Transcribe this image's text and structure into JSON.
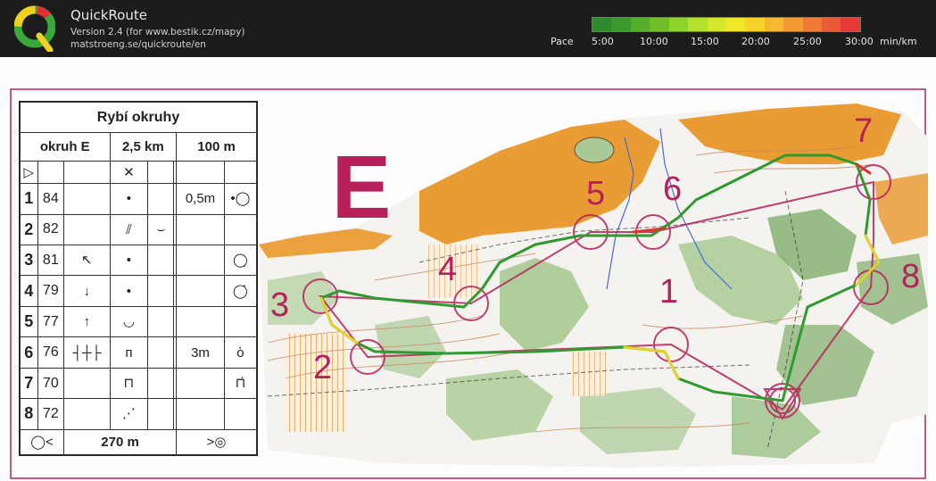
{
  "app": {
    "title": "QuickRoute",
    "version_line": "Version 2.4  (for www.bestik.cz/mapy)",
    "url_line": "matstroeng.se/quickroute/en"
  },
  "pace": {
    "label": "Pace",
    "unit": "min/km",
    "ticks": [
      "5:00",
      "10:00",
      "15:00",
      "20:00",
      "25:00",
      "30:00"
    ],
    "gradient": [
      "#2e8b2e",
      "#3a9a2c",
      "#55ad2a",
      "#70bf28",
      "#8fd22a",
      "#b4e02e",
      "#d6e62e",
      "#f0e62a",
      "#f7d22a",
      "#f6b830",
      "#f39a32",
      "#ee7a34",
      "#ea5a36",
      "#e43a38"
    ]
  },
  "map": {
    "course_letter": "E",
    "control_numbers": [
      "1",
      "2",
      "3",
      "4",
      "5",
      "6",
      "7",
      "8"
    ],
    "colors": {
      "course": "#b8205a",
      "forest_orange": "#e8921e",
      "green": "#7fae6a",
      "route_green": "#2f9a2f",
      "route_yellow": "#e6d22a",
      "route_red": "#d8342a"
    }
  },
  "description": {
    "title": "Rybí okruhy",
    "course": "okruh E",
    "length": "2,5 km",
    "climb": "100 m",
    "start_symbol": "▷",
    "start_feature": "✕",
    "rows": [
      {
        "num": "1",
        "code": "84",
        "c": "",
        "d": "•",
        "e": "",
        "f": "",
        "g": "0,5m",
        "h": "•◯"
      },
      {
        "num": "2",
        "code": "82",
        "c": "",
        "d": "⫽",
        "e": "⌣",
        "f": "",
        "g": "",
        "h": ""
      },
      {
        "num": "3",
        "code": "81",
        "c": "↖",
        "d": "•",
        "e": "",
        "f": "",
        "g": "",
        "h": "◯̣"
      },
      {
        "num": "4",
        "code": "79",
        "c": "↓",
        "d": "•",
        "e": "",
        "f": "",
        "g": "",
        "h": "◯̇"
      },
      {
        "num": "5",
        "code": "77",
        "c": "↑",
        "d": "◡",
        "e": "",
        "f": "",
        "g": "",
        "h": ""
      },
      {
        "num": "6",
        "code": "76",
        "c": "┤┼├",
        "d": "ᴨ",
        "e": "",
        "f": "",
        "g": "3m",
        "h": "ὸ"
      },
      {
        "num": "7",
        "code": "70",
        "c": "",
        "d": "⊓",
        "e": "",
        "f": "",
        "g": "",
        "h": "⊓̇"
      },
      {
        "num": "8",
        "code": "72",
        "c": "",
        "d": "⋰",
        "e": "",
        "f": "",
        "g": "",
        "h": ""
      }
    ],
    "finish_distance": "270 m",
    "finish_left_symbol": "◯<",
    "finish_right_symbol": ">◎"
  }
}
